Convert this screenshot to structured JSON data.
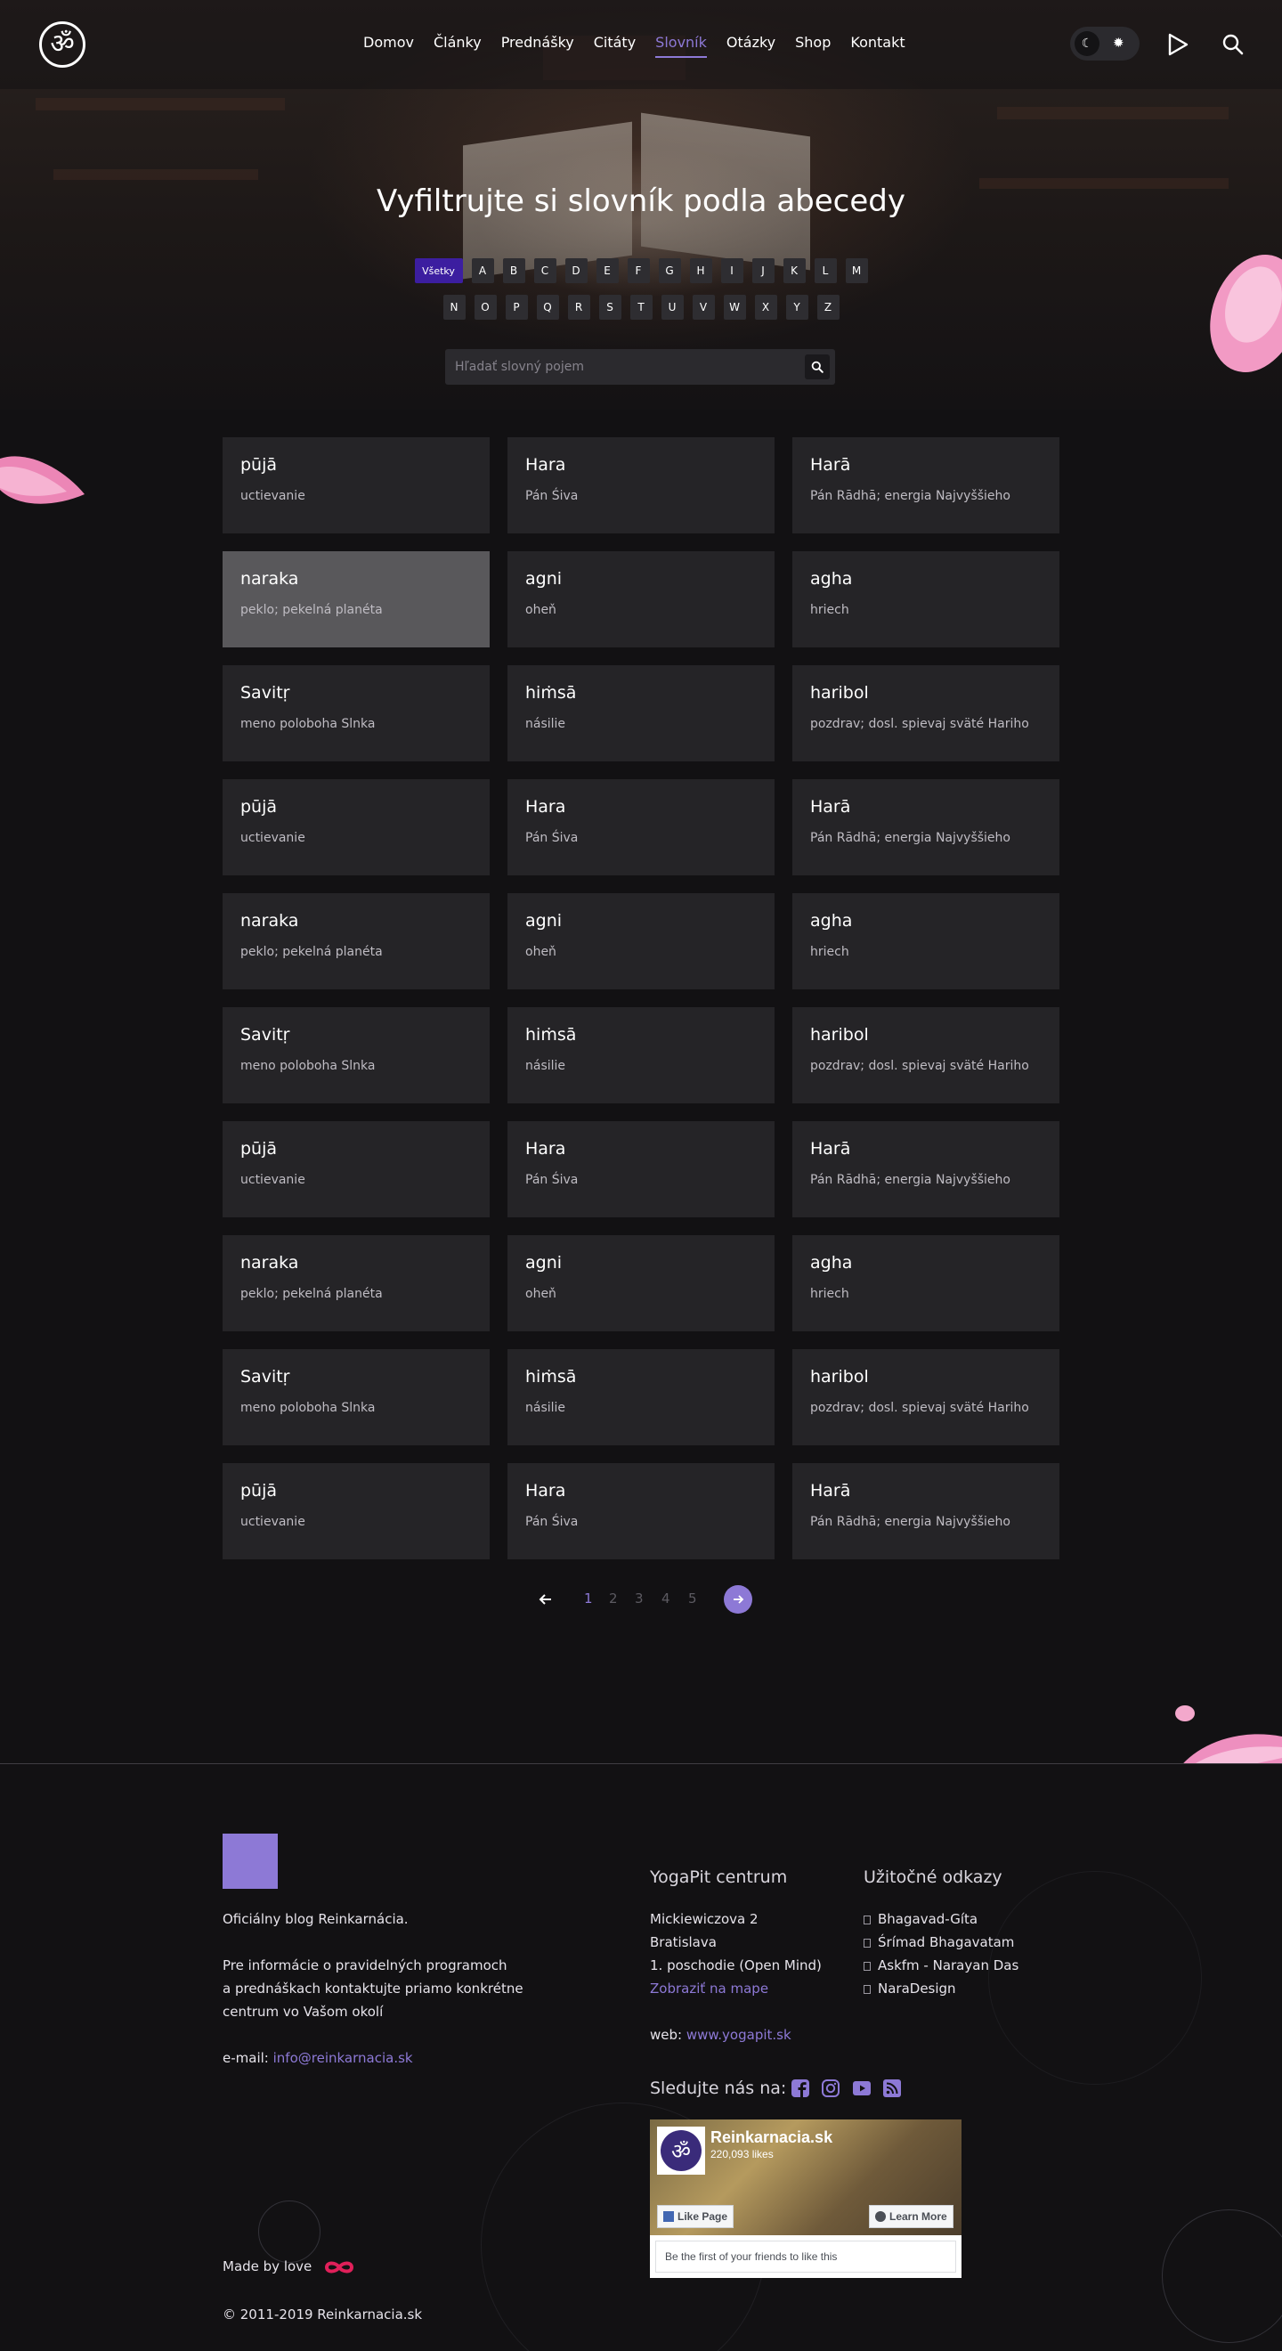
{
  "nav": {
    "items": [
      "Domov",
      "Články",
      "Prednášky",
      "Citáty",
      "Slovník",
      "Otázky",
      "Shop",
      "Kontakt"
    ],
    "active": "Slovník"
  },
  "hero": {
    "title": "Vyfiltrujte si slovník podla abecedy",
    "all_label": "Všetky",
    "letters_row1": [
      "A",
      "B",
      "C",
      "D",
      "E",
      "F",
      "G",
      "H",
      "I",
      "J",
      "K",
      "L",
      "M"
    ],
    "letters_row2": [
      "N",
      "O",
      "P",
      "Q",
      "R",
      "S",
      "T",
      "U",
      "V",
      "W",
      "X",
      "Y",
      "Z"
    ],
    "search_placeholder": "Hľadať slovný pojem"
  },
  "glossary": [
    {
      "term": "pūjā",
      "def": "uctievanie"
    },
    {
      "term": "Hara",
      "def": "Pán Śiva"
    },
    {
      "term": "Harā",
      "def": "Pán Rādhā; energia Najvyššieho"
    },
    {
      "term": "naraka",
      "def": "peklo; pekelná planéta"
    },
    {
      "term": "agni",
      "def": "oheň"
    },
    {
      "term": "agha",
      "def": "hriech"
    },
    {
      "term": "Savitṛ",
      "def": "meno poloboha Slnka"
    },
    {
      "term": "hiṁsā",
      "def": "násilie"
    },
    {
      "term": "haribol",
      "def": "pozdrav; dosl. spievaj sväté Hariho"
    },
    {
      "term": "pūjā",
      "def": "uctievanie"
    },
    {
      "term": "Hara",
      "def": "Pán Śiva"
    },
    {
      "term": "Harā",
      "def": "Pán Rādhā; energia Najvyššieho"
    },
    {
      "term": "naraka",
      "def": "peklo; pekelná planéta"
    },
    {
      "term": "agni",
      "def": "oheň"
    },
    {
      "term": "agha",
      "def": "hriech"
    },
    {
      "term": "Savitṛ",
      "def": "meno poloboha Slnka"
    },
    {
      "term": "hiṁsā",
      "def": "násilie"
    },
    {
      "term": "haribol",
      "def": "pozdrav; dosl. spievaj sväté Hariho"
    },
    {
      "term": "pūjā",
      "def": "uctievanie"
    },
    {
      "term": "Hara",
      "def": "Pán Śiva"
    },
    {
      "term": "Harā",
      "def": "Pán Rādhā; energia Najvyššieho"
    },
    {
      "term": "naraka",
      "def": "peklo; pekelná planéta"
    },
    {
      "term": "agni",
      "def": "oheň"
    },
    {
      "term": "agha",
      "def": "hriech"
    },
    {
      "term": "Savitṛ",
      "def": "meno poloboha Slnka"
    },
    {
      "term": "hiṁsā",
      "def": "násilie"
    },
    {
      "term": "haribol",
      "def": "pozdrav; dosl. spievaj sväté Hariho"
    },
    {
      "term": "pūjā",
      "def": "uctievanie"
    },
    {
      "term": "Hara",
      "def": "Pán Śiva"
    },
    {
      "term": "Harā",
      "def": "Pán Rādhā; energia Najvyššieho"
    }
  ],
  "pagination": {
    "pages": [
      "1",
      "2",
      "3",
      "4",
      "5"
    ],
    "current": "1"
  },
  "footer": {
    "blog_line": "Oficiálny blog Reinkarnácia.",
    "info_line1": "Pre informácie o pravidelných programoch",
    "info_line2": "a prednáškach kontaktujte priamo konkrétne",
    "info_line3": "centrum vo Vašom okolí",
    "email_label": "e-mail:",
    "email": "info@reinkarnacia.sk",
    "made_by": "Made by love",
    "copyright": "© 2011-2019 Reinkarnacia.sk",
    "center": {
      "title": "YogaPit centrum",
      "address1": "Mickiewiczova 2",
      "address2": "Bratislava",
      "address3": "1. poschodie (Open Mind)",
      "map_link": "Zobraziť na mape",
      "web_label": "web:",
      "web": "www.yogapit.sk"
    },
    "links": {
      "title": "Užitočné odkazy",
      "items": [
        "Bhagavad-Gíta",
        "Śrímad Bhagavatam",
        "Askfm - Narayan Das",
        "NaraDesign"
      ]
    },
    "follow": "Sledujte nás na:",
    "fb": {
      "name": "Reinkarnacia.sk",
      "likes": "220,093 likes",
      "like_btn": "Like Page",
      "learn_btn": "Learn More",
      "friends": "Be the first of your friends to like this"
    }
  },
  "colors": {
    "accent": "#8d79d6",
    "all_button": "#3c1ea0",
    "card": "#252427",
    "background": "#121113"
  },
  "icons": [
    "om-logo-icon",
    "moon-icon",
    "sun-icon",
    "play-icon",
    "search-icon",
    "arrow-left-icon",
    "arrow-right-icon",
    "facebook-icon",
    "instagram-icon",
    "youtube-icon",
    "rss-icon",
    "infinity-heart-icon"
  ]
}
